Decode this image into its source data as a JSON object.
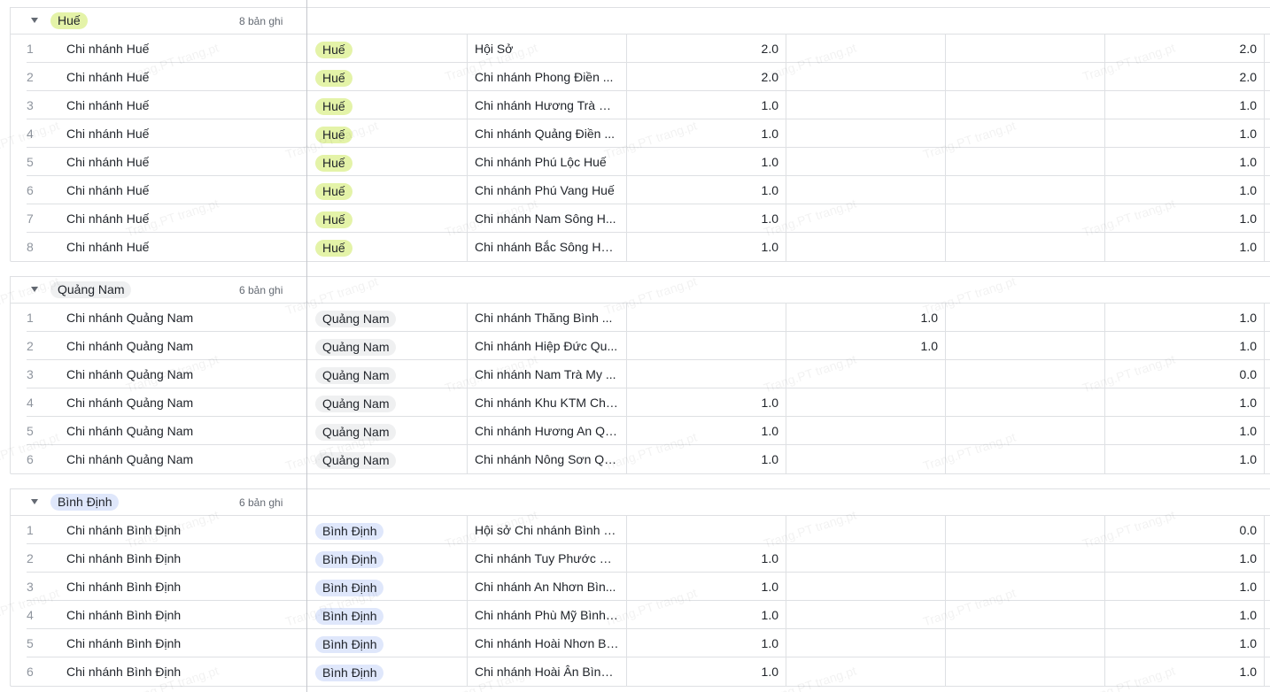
{
  "watermark_text": "Trang.PT trang.pt",
  "colors": {
    "hue_tag": "#e4f3a8",
    "quang_nam_tag": "#eff0f1",
    "binh_dinh_tag": "#dfe7fb",
    "border": "#dee0e3"
  },
  "groups": [
    {
      "tag": "Huế",
      "tag_color": "#e4f3a8",
      "count": "8 bản ghi",
      "rows": [
        {
          "idx": "1",
          "name": "Chi nhánh Huế",
          "region": "Huế",
          "branch": "Hội Sở",
          "n1": "2.0",
          "n2": "",
          "n3": "",
          "n4": "2.0"
        },
        {
          "idx": "2",
          "name": "Chi nhánh Huế",
          "region": "Huế",
          "branch": "Chi nhánh Phong Điền ...",
          "n1": "2.0",
          "n2": "",
          "n3": "",
          "n4": "2.0"
        },
        {
          "idx": "3",
          "name": "Chi nhánh Huế",
          "region": "Huế",
          "branch": "Chi nhánh Hương Trà Huế",
          "n1": "1.0",
          "n2": "",
          "n3": "",
          "n4": "1.0"
        },
        {
          "idx": "4",
          "name": "Chi nhánh Huế",
          "region": "Huế",
          "branch": "Chi nhánh Quảng Điền ...",
          "n1": "1.0",
          "n2": "",
          "n3": "",
          "n4": "1.0"
        },
        {
          "idx": "5",
          "name": "Chi nhánh Huế",
          "region": "Huế",
          "branch": "Chi nhánh Phú Lộc Huế",
          "n1": "1.0",
          "n2": "",
          "n3": "",
          "n4": "1.0"
        },
        {
          "idx": "6",
          "name": "Chi nhánh Huế",
          "region": "Huế",
          "branch": "Chi nhánh Phú Vang Huế",
          "n1": "1.0",
          "n2": "",
          "n3": "",
          "n4": "1.0"
        },
        {
          "idx": "7",
          "name": "Chi nhánh Huế",
          "region": "Huế",
          "branch": "Chi nhánh Nam Sông H...",
          "n1": "1.0",
          "n2": "",
          "n3": "",
          "n4": "1.0"
        },
        {
          "idx": "8",
          "name": "Chi nhánh Huế",
          "region": "Huế",
          "branch": "Chi nhánh Bắc Sông Hư...",
          "n1": "1.0",
          "n2": "",
          "n3": "",
          "n4": "1.0"
        }
      ]
    },
    {
      "tag": "Quảng Nam",
      "tag_color": "#eff0f1",
      "count": "6 bản ghi",
      "rows": [
        {
          "idx": "1",
          "name": "Chi nhánh Quảng Nam",
          "region": "Quảng Nam",
          "branch": "Chi nhánh Thăng Bình ...",
          "n1": "",
          "n2": "1.0",
          "n3": "",
          "n4": "1.0"
        },
        {
          "idx": "2",
          "name": "Chi nhánh Quảng Nam",
          "region": "Quảng Nam",
          "branch": "Chi nhánh Hiệp Đức Qu...",
          "n1": "",
          "n2": "1.0",
          "n3": "",
          "n4": "1.0"
        },
        {
          "idx": "3",
          "name": "Chi nhánh Quảng Nam",
          "region": "Quảng Nam",
          "branch": "Chi nhánh Nam Trà My ...",
          "n1": "",
          "n2": "",
          "n3": "",
          "n4": "0.0"
        },
        {
          "idx": "4",
          "name": "Chi nhánh Quảng Nam",
          "region": "Quảng Nam",
          "branch": "Chi nhánh Khu KTM Chu...",
          "n1": "1.0",
          "n2": "",
          "n3": "",
          "n4": "1.0"
        },
        {
          "idx": "5",
          "name": "Chi nhánh Quảng Nam",
          "region": "Quảng Nam",
          "branch": "Chi nhánh Hương An Qu...",
          "n1": "1.0",
          "n2": "",
          "n3": "",
          "n4": "1.0"
        },
        {
          "idx": "6",
          "name": "Chi nhánh Quảng Nam",
          "region": "Quảng Nam",
          "branch": "Chi nhánh Nông Sơn Qu...",
          "n1": "1.0",
          "n2": "",
          "n3": "",
          "n4": "1.0"
        }
      ]
    },
    {
      "tag": "Bình Định",
      "tag_color": "#dfe7fb",
      "count": "6 bản ghi",
      "rows": [
        {
          "idx": "1",
          "name": "Chi nhánh Bình Định",
          "region": "Bình Định",
          "branch": "Hội sở Chi nhánh Bình Đ...",
          "n1": "",
          "n2": "",
          "n3": "",
          "n4": "0.0"
        },
        {
          "idx": "2",
          "name": "Chi nhánh Bình Định",
          "region": "Bình Định",
          "branch": "Chi nhánh Tuy Phước Bì...",
          "n1": "1.0",
          "n2": "",
          "n3": "",
          "n4": "1.0"
        },
        {
          "idx": "3",
          "name": "Chi nhánh Bình Định",
          "region": "Bình Định",
          "branch": "Chi nhánh An Nhơn Bìn...",
          "n1": "1.0",
          "n2": "",
          "n3": "",
          "n4": "1.0"
        },
        {
          "idx": "4",
          "name": "Chi nhánh Bình Định",
          "region": "Bình Định",
          "branch": "Chi nhánh Phù Mỹ Bình ...",
          "n1": "1.0",
          "n2": "",
          "n3": "",
          "n4": "1.0"
        },
        {
          "idx": "5",
          "name": "Chi nhánh Bình Định",
          "region": "Bình Định",
          "branch": "Chi nhánh Hoài Nhơn Bì...",
          "n1": "1.0",
          "n2": "",
          "n3": "",
          "n4": "1.0"
        },
        {
          "idx": "6",
          "name": "Chi nhánh Bình Định",
          "region": "Bình Định",
          "branch": "Chi nhánh Hoài Ân Bình ...",
          "n1": "1.0",
          "n2": "",
          "n3": "",
          "n4": "1.0"
        }
      ]
    }
  ]
}
